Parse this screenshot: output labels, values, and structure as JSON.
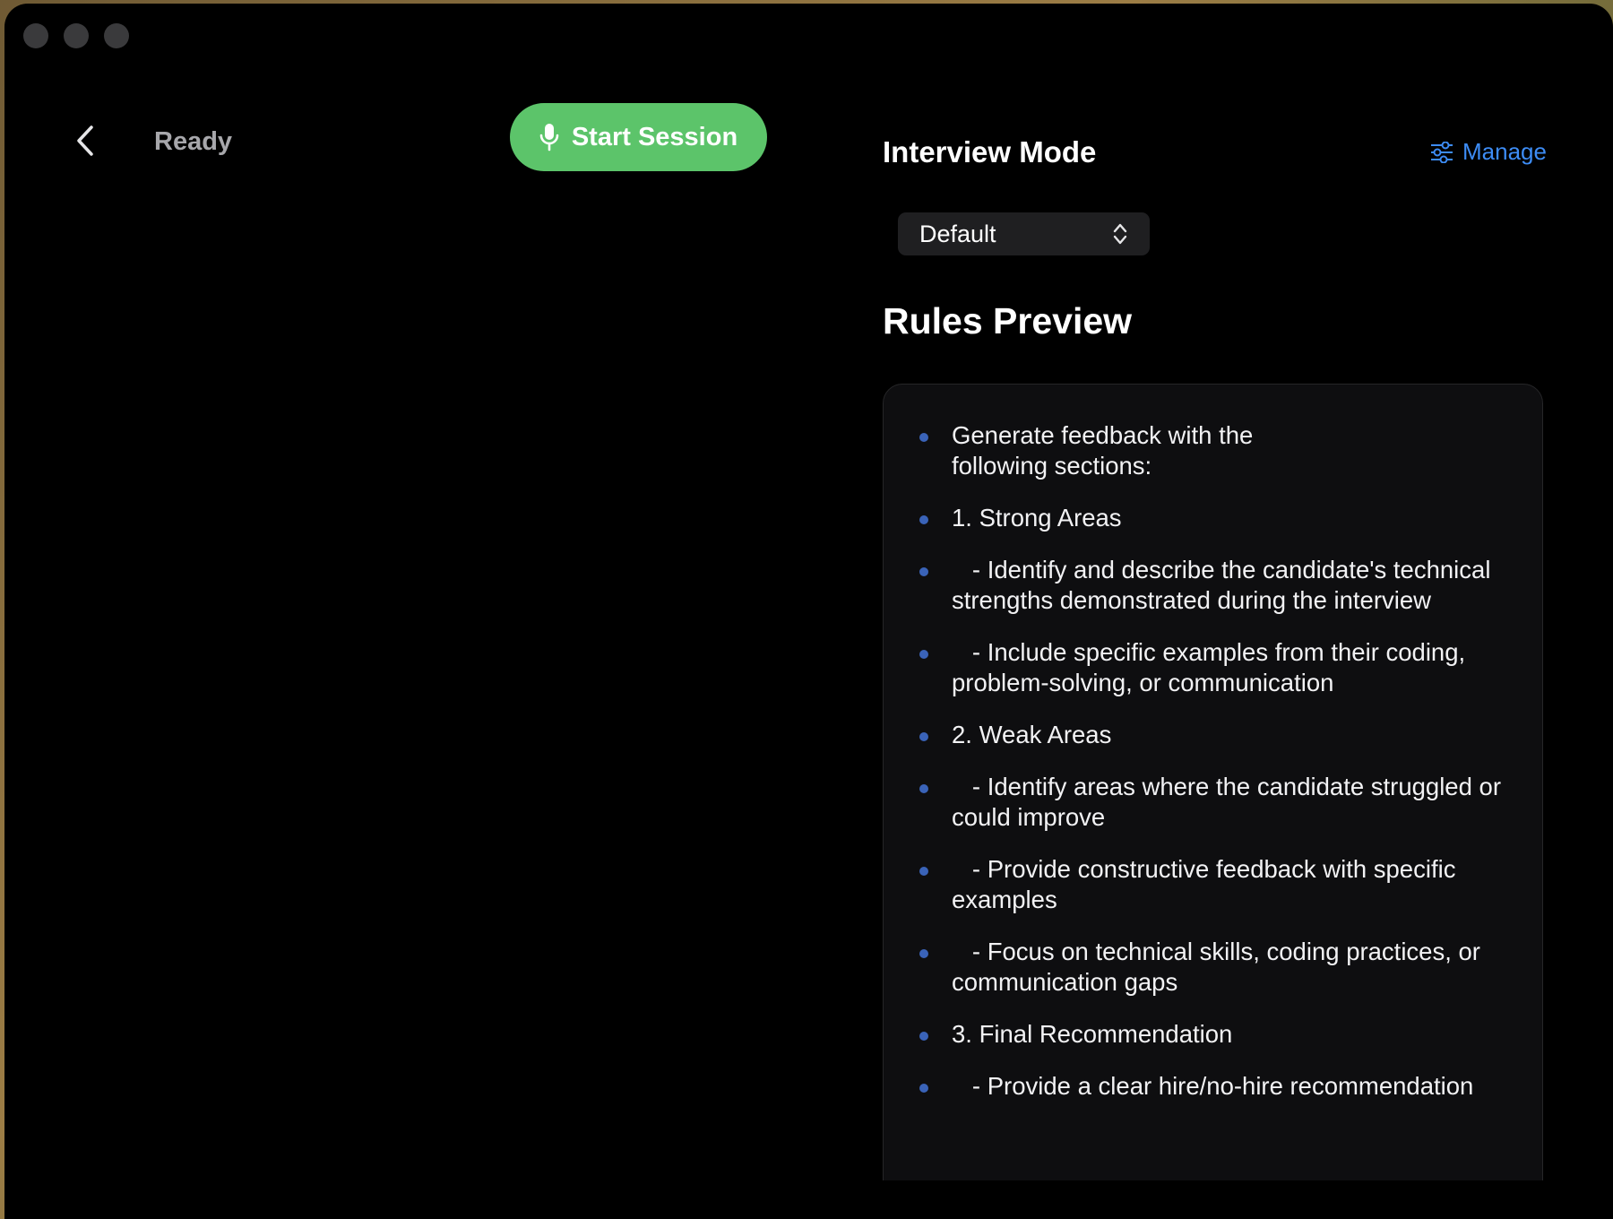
{
  "header": {
    "status": "Ready",
    "start_button_label": "Start Session"
  },
  "interview_mode": {
    "title": "Interview Mode",
    "manage_label": "Manage",
    "selected_mode": "Default"
  },
  "rules_preview": {
    "title": "Rules Preview",
    "items": [
      "Generate feedback with the\nfollowing sections:",
      "1. Strong Areas",
      "   - Identify and describe the candidate's technical strengths demonstrated during the interview",
      "   - Include specific examples from their coding, problem-solving, or communication",
      "2. Weak Areas",
      "   - Identify areas where the candidate struggled or could improve",
      "   - Provide constructive feedback with specific examples",
      "   - Focus on technical skills, coding practices, or communication gaps",
      "3. Final Recommendation",
      "   - Provide a clear hire/no-hire recommendation"
    ]
  },
  "colors": {
    "accent_green": "#5cc46a",
    "link_blue": "#3d8cf5",
    "bullet_blue": "#3a63b8"
  },
  "icons": [
    "back-chevron-icon",
    "microphone-icon",
    "sliders-icon",
    "updown-chevron-icon"
  ]
}
